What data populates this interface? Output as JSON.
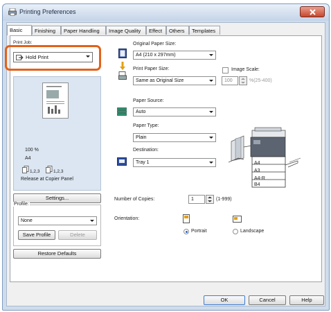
{
  "window": {
    "title": "Printing Preferences"
  },
  "tabs": [
    "Basic",
    "Finishing",
    "Paper Handling",
    "Image Quality",
    "Effect",
    "Others",
    "Templates"
  ],
  "left": {
    "print_job_label": "Print Job:",
    "print_job_value": "Hold Print",
    "preview_zoom": "100 %",
    "preview_paper": "A4",
    "collate_1": "1,2,3",
    "collate_2": "1,2,3",
    "release_note": "Release at Copier Panel",
    "settings_button": "Settings...",
    "profile_label": "Profile:",
    "profile_value": "None",
    "save_profile": "Save Profile",
    "delete": "Delete",
    "restore_defaults": "Restore Defaults"
  },
  "right": {
    "original_paper_size_label": "Original Paper Size:",
    "original_paper_size_value": "A4 (210 x 297mm)",
    "print_paper_size_label": "Print Paper Size:",
    "print_paper_size_value": "Same as Original Size",
    "image_scale_label": "Image Scale:",
    "image_scale_value": "100",
    "image_scale_range": "%(25-400)",
    "paper_source_label": "Paper Source:",
    "paper_source_value": "Auto",
    "paper_type_label": "Paper Type:",
    "paper_type_value": "Plain",
    "destination_label": "Destination:",
    "destination_value": "Tray 1",
    "tray_sizes": [
      "A4",
      "A3",
      "A4-R",
      "B4"
    ],
    "copies_label": "Number of Copies:",
    "copies_value": "1",
    "copies_range": "(1-999)",
    "orientation_label": "Orientation:",
    "portrait": "Portrait",
    "landscape": "Landscape"
  },
  "footer": {
    "ok": "OK",
    "cancel": "Cancel",
    "help": "Help"
  },
  "colors": {
    "highlight": "#e2611a",
    "title_bar": "#c4d4e8",
    "close_button": "#c7462c"
  }
}
